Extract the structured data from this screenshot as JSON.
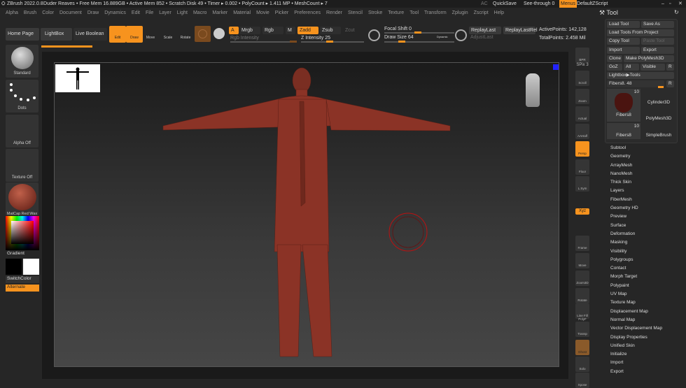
{
  "titlebar": {
    "app": "ZBrush 2022.0.8",
    "doc": "Duder Reaves",
    "stats": "• Free Mem 16.889GB • Active Mem 852 • Scratch Disk 49 • Timer ▸ 0.002 • PolyCount ▸ 1.411 MP • MeshCount ▸ 7",
    "ac": "AC",
    "quicksave": "QuickSave",
    "seethrough": "See-through  0",
    "menus": "Menus",
    "script": "DefaultZScript"
  },
  "menu": [
    "Alpha",
    "Brush",
    "Color",
    "Document",
    "Draw",
    "Dynamics",
    "Edit",
    "File",
    "Layer",
    "Light",
    "Macro",
    "Marker",
    "Material",
    "Movie",
    "Picker",
    "Preferences",
    "Render",
    "Stencil",
    "Stroke",
    "Texture",
    "Tool",
    "Transform",
    "Zplugin",
    "Zscript",
    "Help"
  ],
  "toolbar": {
    "home": "Home Page",
    "lightbox": "LightBox",
    "liveboolean": "Live Boolean",
    "edit": "Edit",
    "draw": "Draw",
    "move": "Move",
    "scale": "Scale",
    "rotate": "Rotate",
    "a": "A",
    "mrgb": "Mrgb",
    "rgb": "Rgb",
    "m": "M",
    "zadd": "Zadd",
    "zsub": "Zsub",
    "zcut": "Zcut",
    "rgb_intensity": "Rgb Intensity",
    "z_intensity": "Z Intensity 25",
    "focal": "Focal Shift 0",
    "drawsize": "Draw Size 64",
    "dynamic": "Dynamic",
    "replaylast": "ReplayLast",
    "replaylastrel": "ReplayLastRel",
    "adjustlast": "AdjustLast",
    "activepoints": "ActivePoints: 142,128",
    "totalpoints": "TotalPoints: 2.458 Mil"
  },
  "left": {
    "brush": "Standard",
    "stroke": "Dots",
    "alpha": "Alpha Off",
    "texture": "Texture Off",
    "material": "MatCap Red Wax",
    "gradient": "Gradient",
    "switch": "SwitchColor",
    "alternate": "Alternate"
  },
  "right_shelf": [
    "BPR",
    "SPix 3",
    "Scroll",
    "Zoom",
    "Actual",
    "AAHalf",
    "Persp",
    "Floor",
    "L.Sym",
    "Xyz",
    "Frame",
    "Move",
    "Zoom3D",
    "Rotate",
    "Line Fill PolyF",
    "Transp",
    "Ghost",
    "Solo",
    "Xpose"
  ],
  "tool": {
    "title": "Tool",
    "load": "Load Tool",
    "saveas": "Save As",
    "loadproj": "Load Tools From Project",
    "copy": "Copy Tool",
    "paste": "Paste Tool",
    "import": "Import",
    "export": "Export",
    "clone": "Clone",
    "makepoly": "Make PolyMesh3D",
    "goz": "GoZ",
    "all": "All",
    "visible": "Visible",
    "r": "R",
    "lightbox": "Lightbox▶Tools",
    "current": "Fibers8. 48",
    "thumbs": [
      {
        "label": "Fibers8",
        "count": "10"
      },
      {
        "label": "Cylinder3D"
      },
      {
        "label": "PolyMesh3D"
      },
      {
        "label": "Fibers8",
        "count": "10"
      },
      {
        "label": "SimpleBrush"
      }
    ],
    "sections": [
      "Subtool",
      "Geometry",
      "ArrayMesh",
      "NanoMesh",
      "Thick Skin",
      "Layers",
      "FiberMesh",
      "Geometry HD",
      "Preview",
      "Surface",
      "Deformation",
      "Masking",
      "Visibility",
      "Polygroups",
      "Contact",
      "Morph Target",
      "Polypaint",
      "UV Map",
      "Texture Map",
      "Displacement Map",
      "Normal Map",
      "Vector Displacement Map",
      "Display Properties",
      "Unified Skin",
      "Initialize",
      "Import",
      "Export"
    ]
  },
  "colors": {
    "accent": "#f7931e",
    "figure": "#8b3326",
    "bg": "#262626"
  }
}
